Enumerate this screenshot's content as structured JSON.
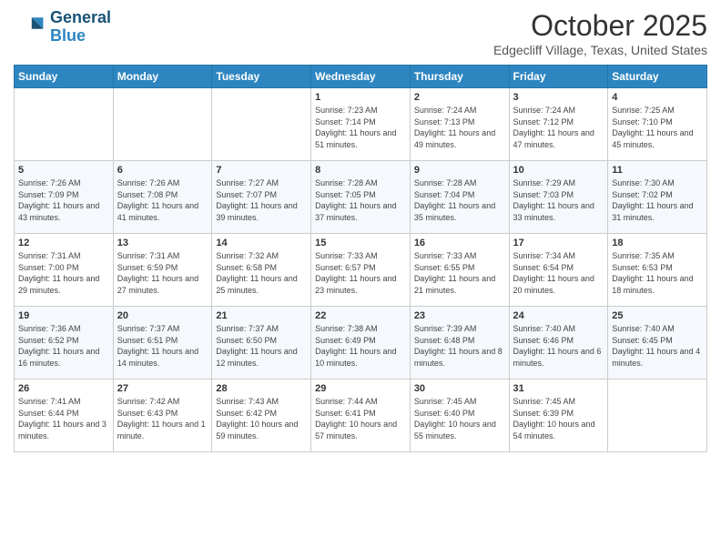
{
  "logo": {
    "line1": "General",
    "line2": "Blue"
  },
  "title": "October 2025",
  "subtitle": "Edgecliff Village, Texas, United States",
  "days_of_week": [
    "Sunday",
    "Monday",
    "Tuesday",
    "Wednesday",
    "Thursday",
    "Friday",
    "Saturday"
  ],
  "weeks": [
    [
      {
        "day": "",
        "sunrise": "",
        "sunset": "",
        "daylight": ""
      },
      {
        "day": "",
        "sunrise": "",
        "sunset": "",
        "daylight": ""
      },
      {
        "day": "",
        "sunrise": "",
        "sunset": "",
        "daylight": ""
      },
      {
        "day": "1",
        "sunrise": "Sunrise: 7:23 AM",
        "sunset": "Sunset: 7:14 PM",
        "daylight": "Daylight: 11 hours and 51 minutes."
      },
      {
        "day": "2",
        "sunrise": "Sunrise: 7:24 AM",
        "sunset": "Sunset: 7:13 PM",
        "daylight": "Daylight: 11 hours and 49 minutes."
      },
      {
        "day": "3",
        "sunrise": "Sunrise: 7:24 AM",
        "sunset": "Sunset: 7:12 PM",
        "daylight": "Daylight: 11 hours and 47 minutes."
      },
      {
        "day": "4",
        "sunrise": "Sunrise: 7:25 AM",
        "sunset": "Sunset: 7:10 PM",
        "daylight": "Daylight: 11 hours and 45 minutes."
      }
    ],
    [
      {
        "day": "5",
        "sunrise": "Sunrise: 7:26 AM",
        "sunset": "Sunset: 7:09 PM",
        "daylight": "Daylight: 11 hours and 43 minutes."
      },
      {
        "day": "6",
        "sunrise": "Sunrise: 7:26 AM",
        "sunset": "Sunset: 7:08 PM",
        "daylight": "Daylight: 11 hours and 41 minutes."
      },
      {
        "day": "7",
        "sunrise": "Sunrise: 7:27 AM",
        "sunset": "Sunset: 7:07 PM",
        "daylight": "Daylight: 11 hours and 39 minutes."
      },
      {
        "day": "8",
        "sunrise": "Sunrise: 7:28 AM",
        "sunset": "Sunset: 7:05 PM",
        "daylight": "Daylight: 11 hours and 37 minutes."
      },
      {
        "day": "9",
        "sunrise": "Sunrise: 7:28 AM",
        "sunset": "Sunset: 7:04 PM",
        "daylight": "Daylight: 11 hours and 35 minutes."
      },
      {
        "day": "10",
        "sunrise": "Sunrise: 7:29 AM",
        "sunset": "Sunset: 7:03 PM",
        "daylight": "Daylight: 11 hours and 33 minutes."
      },
      {
        "day": "11",
        "sunrise": "Sunrise: 7:30 AM",
        "sunset": "Sunset: 7:02 PM",
        "daylight": "Daylight: 11 hours and 31 minutes."
      }
    ],
    [
      {
        "day": "12",
        "sunrise": "Sunrise: 7:31 AM",
        "sunset": "Sunset: 7:00 PM",
        "daylight": "Daylight: 11 hours and 29 minutes."
      },
      {
        "day": "13",
        "sunrise": "Sunrise: 7:31 AM",
        "sunset": "Sunset: 6:59 PM",
        "daylight": "Daylight: 11 hours and 27 minutes."
      },
      {
        "day": "14",
        "sunrise": "Sunrise: 7:32 AM",
        "sunset": "Sunset: 6:58 PM",
        "daylight": "Daylight: 11 hours and 25 minutes."
      },
      {
        "day": "15",
        "sunrise": "Sunrise: 7:33 AM",
        "sunset": "Sunset: 6:57 PM",
        "daylight": "Daylight: 11 hours and 23 minutes."
      },
      {
        "day": "16",
        "sunrise": "Sunrise: 7:33 AM",
        "sunset": "Sunset: 6:55 PM",
        "daylight": "Daylight: 11 hours and 21 minutes."
      },
      {
        "day": "17",
        "sunrise": "Sunrise: 7:34 AM",
        "sunset": "Sunset: 6:54 PM",
        "daylight": "Daylight: 11 hours and 20 minutes."
      },
      {
        "day": "18",
        "sunrise": "Sunrise: 7:35 AM",
        "sunset": "Sunset: 6:53 PM",
        "daylight": "Daylight: 11 hours and 18 minutes."
      }
    ],
    [
      {
        "day": "19",
        "sunrise": "Sunrise: 7:36 AM",
        "sunset": "Sunset: 6:52 PM",
        "daylight": "Daylight: 11 hours and 16 minutes."
      },
      {
        "day": "20",
        "sunrise": "Sunrise: 7:37 AM",
        "sunset": "Sunset: 6:51 PM",
        "daylight": "Daylight: 11 hours and 14 minutes."
      },
      {
        "day": "21",
        "sunrise": "Sunrise: 7:37 AM",
        "sunset": "Sunset: 6:50 PM",
        "daylight": "Daylight: 11 hours and 12 minutes."
      },
      {
        "day": "22",
        "sunrise": "Sunrise: 7:38 AM",
        "sunset": "Sunset: 6:49 PM",
        "daylight": "Daylight: 11 hours and 10 minutes."
      },
      {
        "day": "23",
        "sunrise": "Sunrise: 7:39 AM",
        "sunset": "Sunset: 6:48 PM",
        "daylight": "Daylight: 11 hours and 8 minutes."
      },
      {
        "day": "24",
        "sunrise": "Sunrise: 7:40 AM",
        "sunset": "Sunset: 6:46 PM",
        "daylight": "Daylight: 11 hours and 6 minutes."
      },
      {
        "day": "25",
        "sunrise": "Sunrise: 7:40 AM",
        "sunset": "Sunset: 6:45 PM",
        "daylight": "Daylight: 11 hours and 4 minutes."
      }
    ],
    [
      {
        "day": "26",
        "sunrise": "Sunrise: 7:41 AM",
        "sunset": "Sunset: 6:44 PM",
        "daylight": "Daylight: 11 hours and 3 minutes."
      },
      {
        "day": "27",
        "sunrise": "Sunrise: 7:42 AM",
        "sunset": "Sunset: 6:43 PM",
        "daylight": "Daylight: 11 hours and 1 minute."
      },
      {
        "day": "28",
        "sunrise": "Sunrise: 7:43 AM",
        "sunset": "Sunset: 6:42 PM",
        "daylight": "Daylight: 10 hours and 59 minutes."
      },
      {
        "day": "29",
        "sunrise": "Sunrise: 7:44 AM",
        "sunset": "Sunset: 6:41 PM",
        "daylight": "Daylight: 10 hours and 57 minutes."
      },
      {
        "day": "30",
        "sunrise": "Sunrise: 7:45 AM",
        "sunset": "Sunset: 6:40 PM",
        "daylight": "Daylight: 10 hours and 55 minutes."
      },
      {
        "day": "31",
        "sunrise": "Sunrise: 7:45 AM",
        "sunset": "Sunset: 6:39 PM",
        "daylight": "Daylight: 10 hours and 54 minutes."
      },
      {
        "day": "",
        "sunrise": "",
        "sunset": "",
        "daylight": ""
      }
    ]
  ]
}
